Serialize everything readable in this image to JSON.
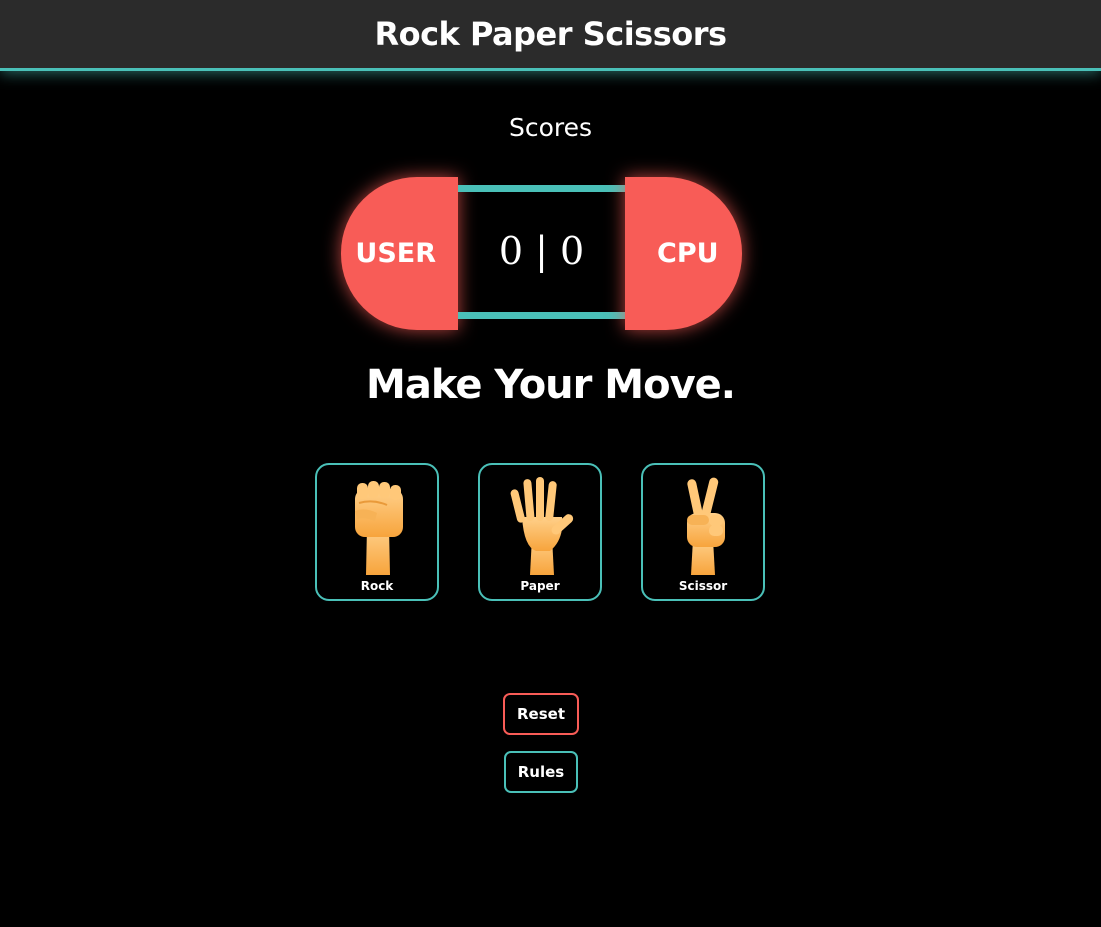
{
  "header": {
    "title": "Rock Paper Scissors"
  },
  "scores": {
    "label": "Scores",
    "user_label": "USER",
    "cpu_label": "CPU",
    "display": "0 | 0",
    "user_score": 0,
    "cpu_score": 0
  },
  "prompt": "Make Your Move.",
  "choices": [
    {
      "label": "Rock",
      "icon": "raised-fist-icon"
    },
    {
      "label": "Paper",
      "icon": "raised-hand-icon"
    },
    {
      "label": "Scissor",
      "icon": "victory-hand-icon"
    }
  ],
  "buttons": {
    "reset_label": "Reset",
    "rules_label": "Rules"
  },
  "colors": {
    "accent_teal": "#4ac0b8",
    "accent_red": "#f85c57",
    "header_bg": "#2b2b2b",
    "page_bg": "#000000",
    "hand_skin": "#fdb95a"
  }
}
